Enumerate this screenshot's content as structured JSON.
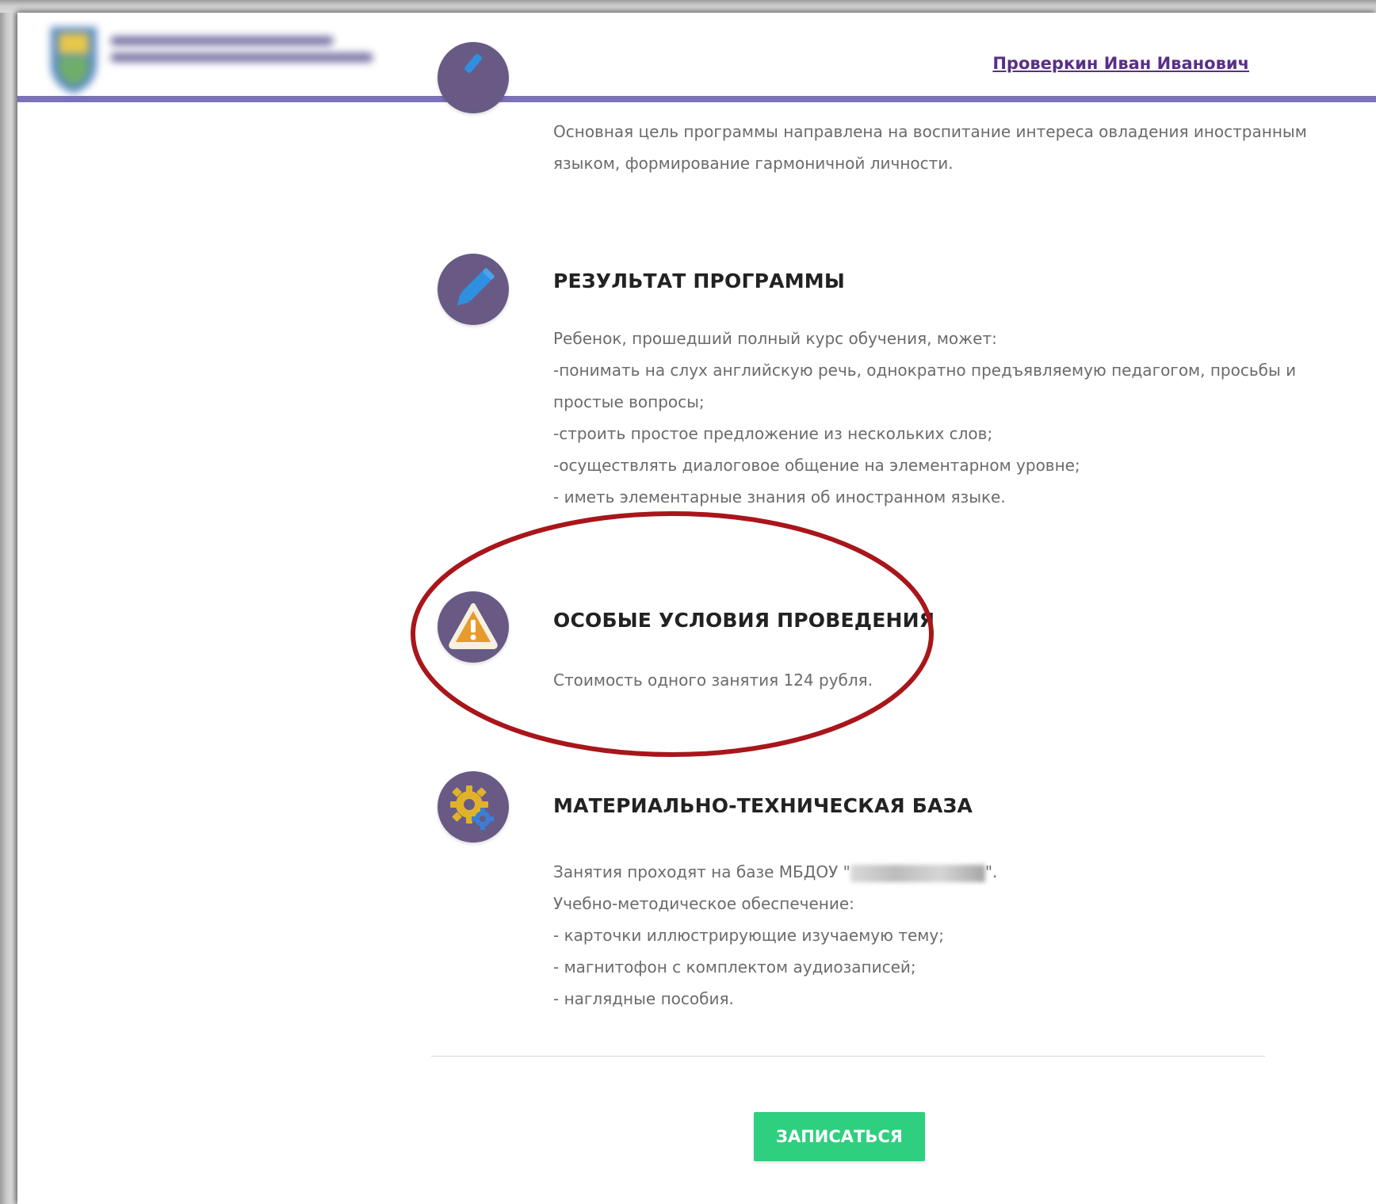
{
  "header": {
    "user_name": "Проверкин Иван Иванович"
  },
  "sections": [
    {
      "icon": "pencil-icon",
      "lines": [
        "Основная цель программы направлена на воспитание интереса овладения иностранным",
        "языком, формирование гармоничной личности."
      ]
    },
    {
      "icon": "pencil-icon",
      "title": "РЕЗУЛЬТАТ ПРОГРАММЫ",
      "lines": [
        "Ребенок, прошедший полный курс обучения, может:",
        "-понимать на слух английскую речь, однократно предъявляемую педагогом, просьбы и",
        "простые вопросы;",
        "-строить простое предложение из нескольких слов;",
        "-осуществлять диалоговое общение на элементарном уровне;",
        "- иметь элементарные знания об иностранном языке."
      ]
    },
    {
      "icon": "warning-icon",
      "title": "ОСОБЫЕ УСЛОВИЯ ПРОВЕДЕНИЯ",
      "lines": [
        "Стоимость одного занятия 124 рубля."
      ]
    },
    {
      "icon": "gear-icon",
      "title": "МАТЕРИАЛЬНО-ТЕХНИЧЕСКАЯ БАЗА",
      "line_prefix": "Занятия проходят на базе МБДОУ \"",
      "line_suffix": "\".",
      "lines": [
        "Учебно-методическое обеспечение:",
        "- карточки иллюстрирующие изучаемую тему;",
        "- магнитофон с комплектом аудиозаписей;",
        "- наглядные пособия."
      ]
    }
  ],
  "actions": {
    "enroll_label": "ЗАПИСАТЬСЯ"
  },
  "colors": {
    "header_border": "#7b72b8",
    "icon_circle": "#685a85",
    "button": "#2fcf80",
    "annotation": "#a8161b",
    "user_link": "#5a2f86"
  }
}
